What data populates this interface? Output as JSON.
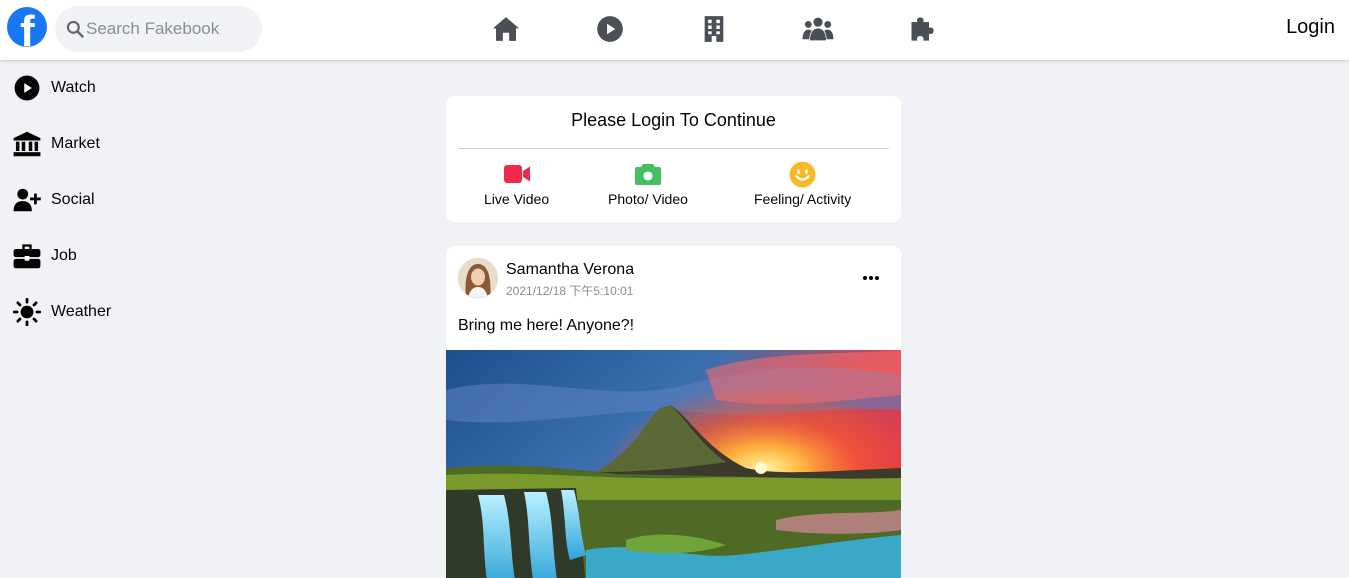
{
  "brand": {
    "logo_letter": "f",
    "color": "#1877f2"
  },
  "search": {
    "placeholder": "Search Fakebook"
  },
  "nav": {
    "icons": [
      "home-icon",
      "play-circle-icon",
      "building-icon",
      "group-icon",
      "puzzle-icon"
    ],
    "login_label": "Login"
  },
  "sidebar": {
    "items": [
      {
        "label": "Watch",
        "icon": "play-circle-icon"
      },
      {
        "label": "Market",
        "icon": "bank-icon"
      },
      {
        "label": "Social",
        "icon": "user-plus-icon"
      },
      {
        "label": "Job",
        "icon": "briefcase-icon"
      },
      {
        "label": "Weather",
        "icon": "sun-icon"
      }
    ]
  },
  "login_card": {
    "title": "Please Login To Continue",
    "actions": [
      {
        "label": "Live Video",
        "icon": "video-camera-icon",
        "color": "#f02849"
      },
      {
        "label": "Photo/ Video",
        "icon": "camera-icon",
        "color": "#45bd62"
      },
      {
        "label": "Feeling/ Activity",
        "icon": "smile-icon",
        "color": "#f7b928"
      }
    ]
  },
  "post": {
    "author": "Samantha Verona",
    "timestamp": "2021/12/18 下午5:10:01",
    "text": "Bring me here! Anyone?!",
    "image": "mountain-waterfall-sunset-photo"
  }
}
